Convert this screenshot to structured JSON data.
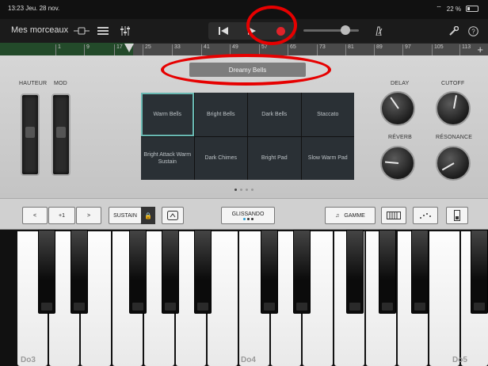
{
  "status_bar": {
    "time_date": "13:23  Jeu. 28 nov.",
    "battery": "22 %"
  },
  "toolbar": {
    "title": "Mes morceaux",
    "icons": [
      "view-toggle-icon",
      "tracks-list-icon",
      "mixer-icon",
      "rewind-icon",
      "play-icon",
      "record-icon",
      "metronome-icon",
      "wrench-icon",
      "help-icon"
    ],
    "record_color": "#e0232a"
  },
  "ruler": {
    "bars": [
      "1",
      "9",
      "17",
      "25",
      "33",
      "41",
      "49",
      "57",
      "65",
      "73",
      "81",
      "89",
      "97",
      "105",
      "113"
    ],
    "region_color": "#234a2a"
  },
  "preset": {
    "name": "Dreamy Bells"
  },
  "wheels": {
    "pitch_label": "HAUTEUR",
    "mod_label": "MOD"
  },
  "pads": [
    {
      "label": "Warm Bells",
      "active": true
    },
    {
      "label": "Bright Bells",
      "active": false
    },
    {
      "label": "Dark Bells",
      "active": false
    },
    {
      "label": "Staccato",
      "active": false
    },
    {
      "label": "Bright Attack Warm Sustain",
      "active": false
    },
    {
      "label": "Dark Chimes",
      "active": false
    },
    {
      "label": "Bright Pad",
      "active": false
    },
    {
      "label": "Slow Warm Pad",
      "active": false
    }
  ],
  "page_dots": {
    "count": 4,
    "current": 1
  },
  "knobs": {
    "delay": "DELAY",
    "cutoff": "CUTOFF",
    "reverb": "RÉVERB",
    "resonance": "RÉSONANCE"
  },
  "controls": {
    "octave_down": "<",
    "octave_value": "+1",
    "octave_up": ">",
    "sustain": "SUSTAIN",
    "glissando": "GLISSANDO",
    "scale": "GAMME"
  },
  "keyboard": {
    "labels": [
      "Do3",
      "Do4",
      "Do5"
    ]
  },
  "annotation_color": "#e60000"
}
